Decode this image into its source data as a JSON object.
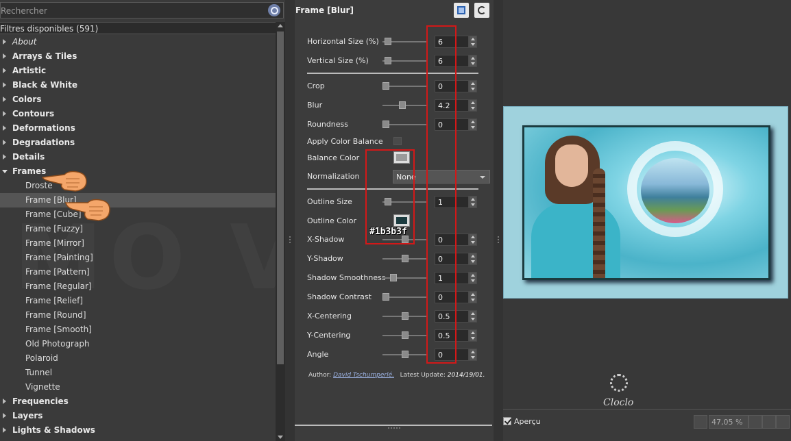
{
  "search": {
    "placeholder": "Rechercher",
    "icon": "search-icon"
  },
  "filters_header": "Filtres disponibles (591)",
  "tree": [
    {
      "label": "About",
      "type": "italic"
    },
    {
      "label": "Arrays & Tiles",
      "type": "category"
    },
    {
      "label": "Artistic",
      "type": "category"
    },
    {
      "label": "Black & White",
      "type": "category"
    },
    {
      "label": "Colors",
      "type": "category"
    },
    {
      "label": "Contours",
      "type": "category"
    },
    {
      "label": "Deformations",
      "type": "category"
    },
    {
      "label": "Degradations",
      "type": "category"
    },
    {
      "label": "Details",
      "type": "category"
    },
    {
      "label": "Frames",
      "type": "open"
    },
    {
      "label": "Droste",
      "type": "child"
    },
    {
      "label": "Frame [Blur]",
      "type": "child-selected"
    },
    {
      "label": "Frame [Cube]",
      "type": "child"
    },
    {
      "label": "Frame [Fuzzy]",
      "type": "child"
    },
    {
      "label": "Frame [Mirror]",
      "type": "child"
    },
    {
      "label": "Frame [Painting]",
      "type": "child"
    },
    {
      "label": "Frame [Pattern]",
      "type": "child"
    },
    {
      "label": "Frame [Regular]",
      "type": "child"
    },
    {
      "label": "Frame [Relief]",
      "type": "child"
    },
    {
      "label": "Frame [Round]",
      "type": "child"
    },
    {
      "label": "Frame [Smooth]",
      "type": "child"
    },
    {
      "label": "Old Photograph",
      "type": "child"
    },
    {
      "label": "Polaroid",
      "type": "child"
    },
    {
      "label": "Tunnel",
      "type": "child"
    },
    {
      "label": "Vignette",
      "type": "child"
    },
    {
      "label": "Frequencies",
      "type": "category"
    },
    {
      "label": "Layers",
      "type": "category"
    },
    {
      "label": "Lights & Shadows",
      "type": "category"
    }
  ],
  "filter_panel": {
    "title": "Frame [Blur]",
    "params": [
      {
        "label": "Horizontal Size (%)",
        "kind": "slider",
        "value": "6",
        "fraction": 0.06
      },
      {
        "label": "Vertical Size (%)",
        "kind": "slider",
        "value": "6",
        "fraction": 0.06
      },
      {
        "kind": "separator"
      },
      {
        "label": "Crop",
        "kind": "slider",
        "value": "0",
        "fraction": 0.0
      },
      {
        "label": "Blur",
        "kind": "slider",
        "value": "4.2",
        "fraction": 0.42
      },
      {
        "label": "Roundness",
        "kind": "slider",
        "value": "0",
        "fraction": 0.0
      },
      {
        "label": "Apply Color Balance",
        "kind": "checkbox"
      },
      {
        "label": "Balance Color",
        "kind": "color",
        "color": "#9a9a9a"
      },
      {
        "label": "Normalization",
        "kind": "select",
        "value": "None"
      },
      {
        "kind": "separator"
      },
      {
        "label": "Outline Size",
        "kind": "slider",
        "value": "1",
        "fraction": 0.05
      },
      {
        "label": "Outline Color",
        "kind": "color",
        "color": "#1b3b3f"
      },
      {
        "label": "X-Shadow",
        "kind": "slider",
        "value": "0",
        "fraction": 0.5
      },
      {
        "label": "Y-Shadow",
        "kind": "slider",
        "value": "0",
        "fraction": 0.5
      },
      {
        "label": "Shadow Smoothness",
        "kind": "slider",
        "value": "1",
        "fraction": 0.2
      },
      {
        "label": "Shadow Contrast",
        "kind": "slider",
        "value": "0",
        "fraction": 0.0
      },
      {
        "label": "X-Centering",
        "kind": "slider",
        "value": "0.5",
        "fraction": 0.5
      },
      {
        "label": "Y-Centering",
        "kind": "slider",
        "value": "0.5",
        "fraction": 0.5
      },
      {
        "label": "Angle",
        "kind": "slider",
        "value": "0",
        "fraction": 0.5
      }
    ],
    "hex_annotation": "#1b3b3f",
    "author_label": "Author:",
    "author_name": "David Tschumperlé.",
    "update_label": "Latest Update:",
    "update_date": "2014/19/01."
  },
  "preview": {
    "apercu_label": "Aperçu",
    "zoom": "47,05 %",
    "logo_text": "Cloclo"
  },
  "colors": {
    "annotation_red": "#d31818",
    "selection": "#555555"
  }
}
